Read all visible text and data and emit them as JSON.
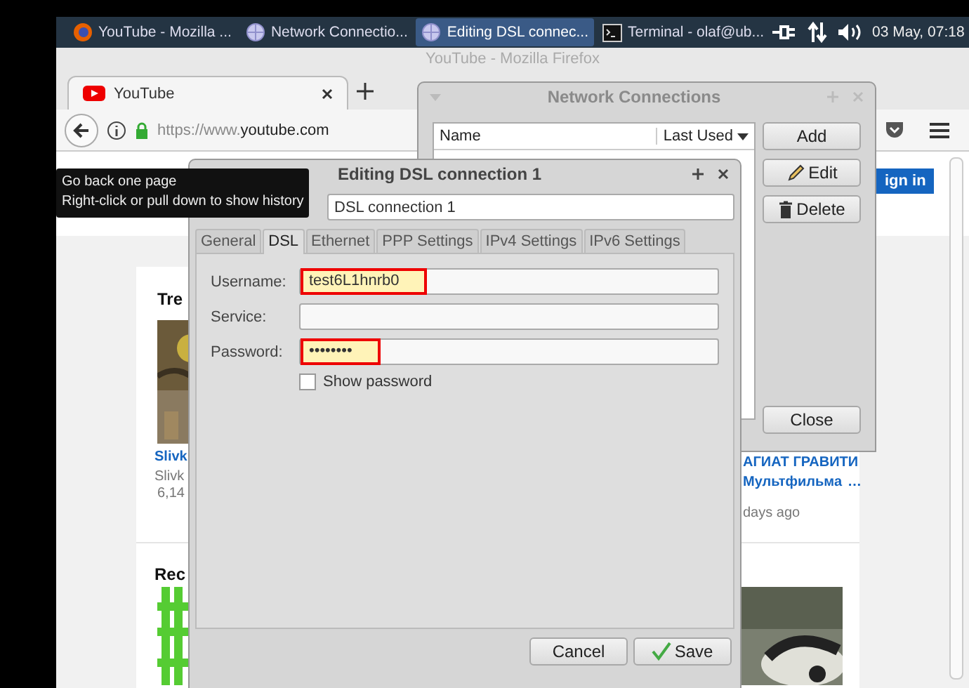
{
  "taskbar": {
    "items": [
      {
        "kind": "firefox",
        "label": "YouTube - Mozilla ...",
        "selected": false
      },
      {
        "kind": "globe",
        "label": "Network Connectio...",
        "selected": false
      },
      {
        "kind": "globe",
        "label": "Editing DSL connec...",
        "selected": true
      },
      {
        "kind": "terminal",
        "label": "Terminal - olaf@ub...",
        "selected": false
      }
    ],
    "clock": "03 May, 07:18"
  },
  "firefox": {
    "title": "YouTube - Mozilla Firefox",
    "tab": {
      "label": "YouTube"
    },
    "url": {
      "scheme": "https://www.",
      "domain": "youtube.com"
    },
    "tooltip": [
      "Go back one page",
      "Right-click or pull down to show history"
    ],
    "page": {
      "sign_in": "ign in",
      "section_1": "Tre",
      "section_2": "Rec",
      "left_video": {
        "title": "Slivk",
        "channel": "Slivk",
        "views": "6,14"
      },
      "right_video": {
        "title": "АГИАТ ГРАВИТИ",
        "subtitle": "Мультфильма",
        "more": "…",
        "age": "days ago"
      }
    }
  },
  "network_connections": {
    "title": "Network Connections",
    "columns": [
      "Name",
      "Last Used"
    ],
    "buttons": [
      {
        "kind": "plain",
        "label": "Add"
      },
      {
        "kind": "edit",
        "label": "Edit"
      },
      {
        "kind": "delete",
        "label": "Delete"
      }
    ],
    "close": "Close"
  },
  "editing": {
    "title": "Editing DSL connection 1",
    "connection_name": "DSL connection 1",
    "tabs": [
      {
        "label": "General",
        "selected": false
      },
      {
        "label": "DSL",
        "selected": true
      },
      {
        "label": "Ethernet",
        "selected": false
      },
      {
        "label": "PPP Settings",
        "selected": false
      },
      {
        "label": "IPv4 Settings",
        "selected": false
      },
      {
        "label": "IPv6 Settings",
        "selected": false
      }
    ],
    "fields": [
      {
        "label": "Username:",
        "value": "test6L1hnrb0",
        "highlighted": true
      },
      {
        "label": "Service:",
        "highlighted": false
      },
      {
        "label": "Password:",
        "value": "••••••••",
        "highlighted": true
      }
    ],
    "show_password": {
      "label": "Show password",
      "checked": false
    },
    "buttons": [
      {
        "kind": "plain",
        "label": "Cancel"
      },
      {
        "kind": "save",
        "label": "Save"
      }
    ]
  }
}
